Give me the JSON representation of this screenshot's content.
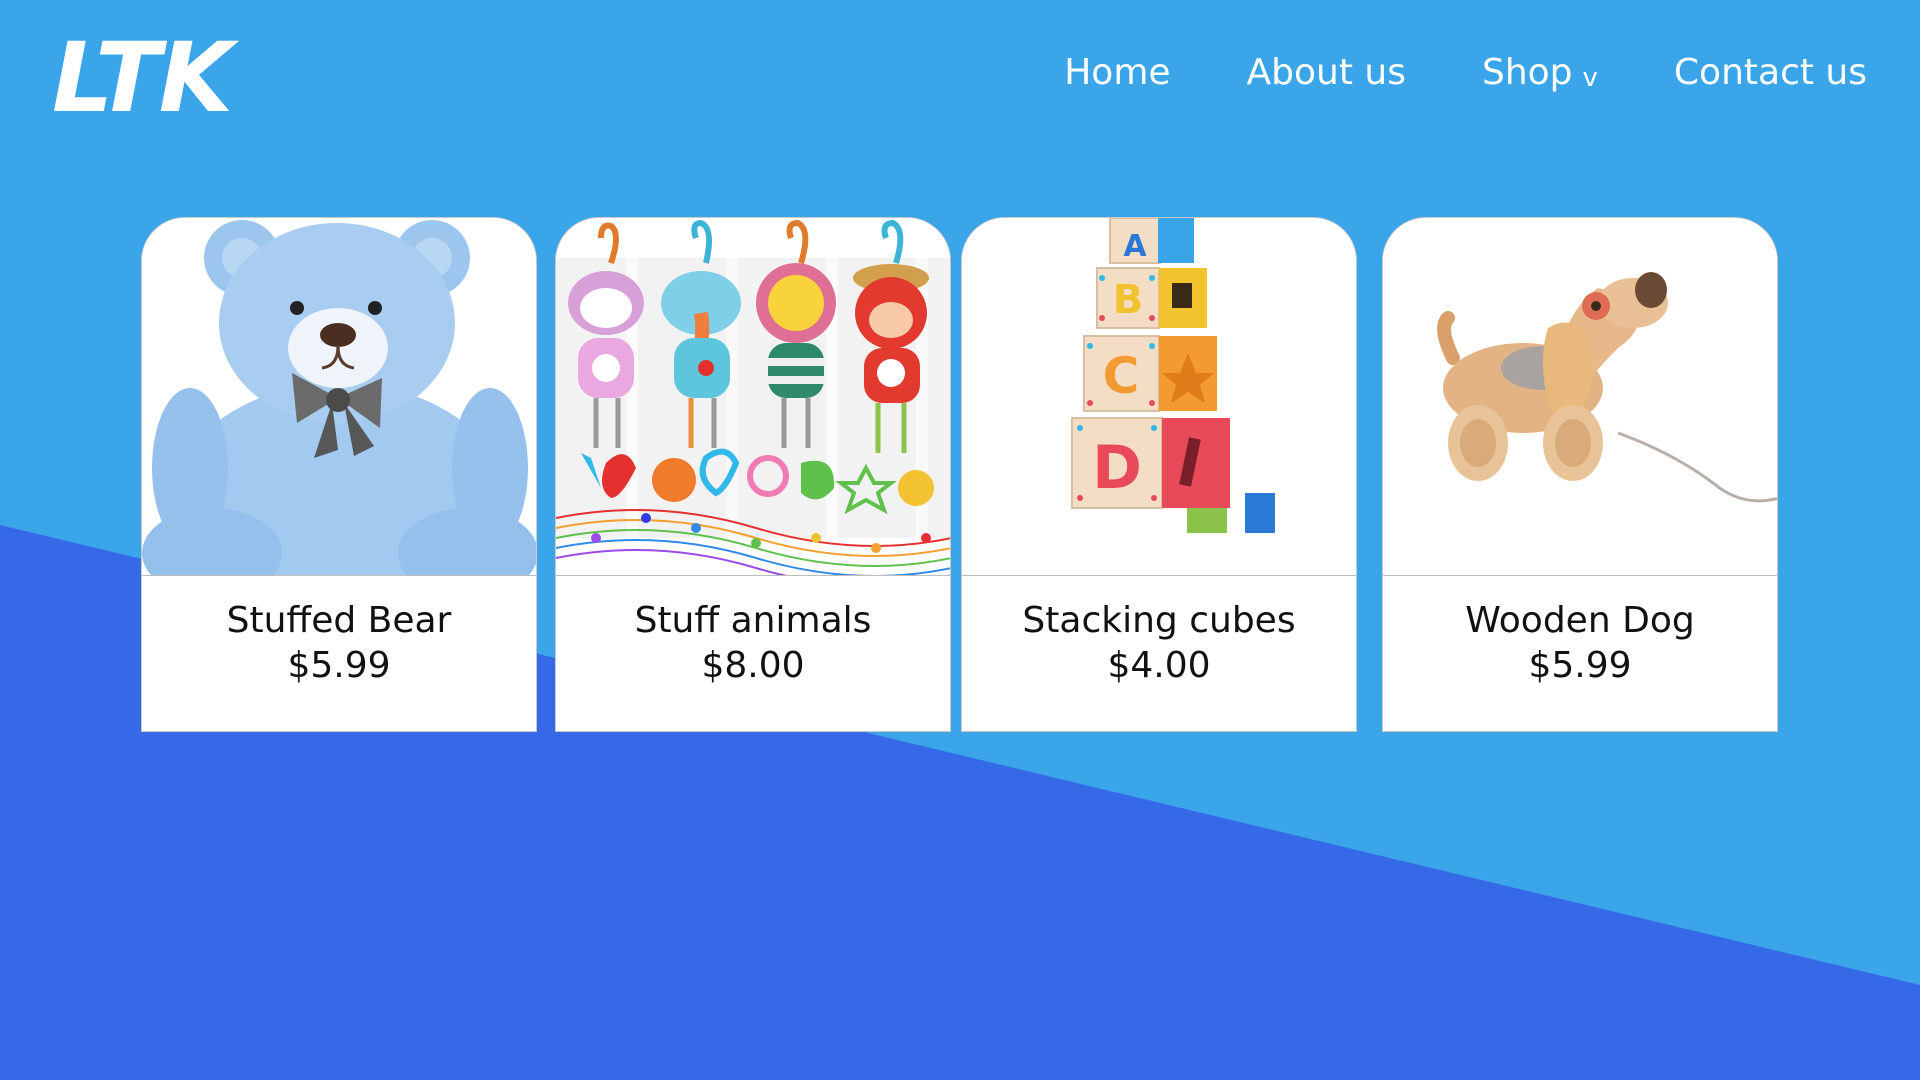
{
  "brand": {
    "logo": "LTK"
  },
  "nav": {
    "items": [
      {
        "label": "Home"
      },
      {
        "label": "About us"
      },
      {
        "label": "Shop",
        "chevron": "v"
      },
      {
        "label": "Contact us"
      }
    ]
  },
  "products": [
    {
      "name": "Stuffed Bear",
      "price": "$5.99",
      "image_icon": "teddy-bear-image"
    },
    {
      "name": "Stuff animals",
      "price": "$8.00",
      "image_icon": "hanging-plush-toys-image"
    },
    {
      "name": "Stacking cubes",
      "price": "$4.00",
      "image_icon": "stacking-blocks-image"
    },
    {
      "name": "Wooden Dog",
      "price": "$5.99",
      "image_icon": "wooden-pull-dog-image"
    }
  ],
  "colors": {
    "background_light": "#3aa5e9",
    "background_dark": "#3569e8",
    "card_background": "#ffffff",
    "text": "#111111",
    "nav_text": "#ffffff"
  }
}
